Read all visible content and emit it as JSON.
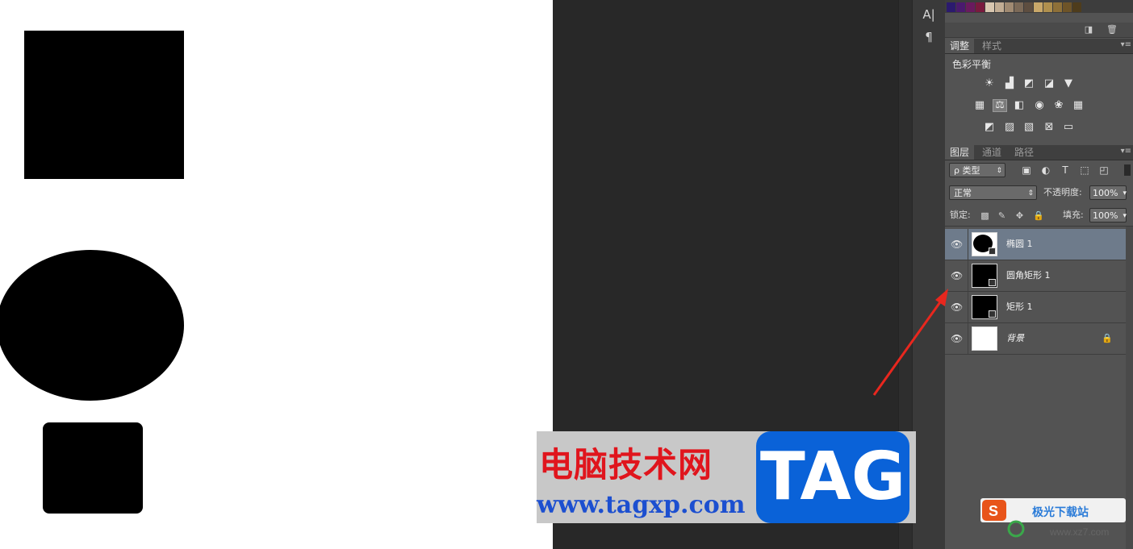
{
  "adjustments_panel": {
    "tabs": [
      "调整",
      "样式"
    ],
    "active_tab": 0,
    "current_adjustment": "色彩平衡",
    "icon_rows": [
      [
        "brightness-contrast-icon",
        "levels-icon",
        "curves-icon",
        "exposure-icon",
        "vibrance-icon"
      ],
      [
        "hue-saturation-icon",
        "color-balance-icon",
        "black-white-icon",
        "photo-filter-icon",
        "channel-mixer-icon",
        "color-lookup-icon"
      ],
      [
        "invert-icon",
        "posterize-icon",
        "threshold-icon",
        "selective-color-icon",
        "gradient-map-icon"
      ]
    ]
  },
  "layers_panel": {
    "tabs": [
      "图层",
      "通道",
      "路径"
    ],
    "active_tab": 0,
    "filter_kind": "ρ 类型",
    "blend_mode": "正常",
    "opacity_label": "不透明度:",
    "opacity_value": "100%",
    "lock_label": "锁定:",
    "fill_label": "填充:",
    "fill_value": "100%",
    "layers": [
      {
        "name": "椭圆 1",
        "selected": true,
        "thumb": "ellipse"
      },
      {
        "name": "圆角矩形 1",
        "selected": false,
        "thumb": "black"
      },
      {
        "name": "矩形 1",
        "selected": false,
        "thumb": "black"
      },
      {
        "name": "背景",
        "selected": false,
        "thumb": "white",
        "locked": true
      }
    ]
  },
  "watermark": {
    "title": "电脑技术网",
    "url": "www.tagxp.com",
    "badge": "TAG"
  },
  "corner_logo": {
    "text": "极光下载站",
    "url": "www.xz7.com"
  },
  "colors": {
    "canvas": "#ffffff",
    "shape_fill": "#000000",
    "panel_bg": "#535353",
    "selected_layer": "#6e7b8b",
    "arrow": "#e8271e"
  }
}
